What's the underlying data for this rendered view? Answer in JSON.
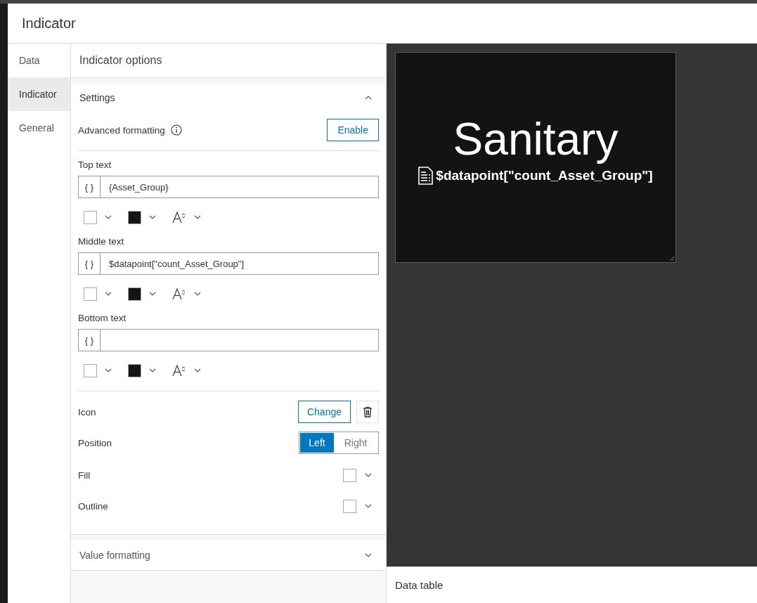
{
  "dialog": {
    "title": "Indicator"
  },
  "nav": [
    {
      "label": "Data",
      "selected": false
    },
    {
      "label": "Indicator",
      "selected": true
    },
    {
      "label": "General",
      "selected": false
    }
  ],
  "options": {
    "title": "Indicator options",
    "settings": {
      "title": "Settings",
      "expanded": true,
      "advanced_formatting": {
        "label": "Advanced formatting",
        "button": "Enable"
      },
      "text_fields": [
        {
          "label": "Top text",
          "prefix": "{ }",
          "value": "{Asset_Group}"
        },
        {
          "label": "Middle text",
          "prefix": "{ }",
          "value": "$datapoint[\"count_Asset_Group\"]"
        },
        {
          "label": "Bottom text",
          "prefix": "{ }"
        }
      ],
      "icon": {
        "label": "Icon",
        "button": "Change"
      },
      "position": {
        "label": "Position",
        "options": [
          {
            "label": "Left",
            "selected": true
          },
          {
            "label": "Right",
            "selected": false
          }
        ]
      },
      "fill": {
        "label": "Fill",
        "color": "#ffffff"
      },
      "outline": {
        "label": "Outline",
        "color": "#ffffff"
      }
    },
    "value_formatting": {
      "title": "Value formatting",
      "expanded": false
    }
  },
  "preview": {
    "top_text": "Sanitary",
    "middle_text": "$datapoint[\"count_Asset_Group\"]"
  },
  "data_table": {
    "title": "Data table"
  }
}
